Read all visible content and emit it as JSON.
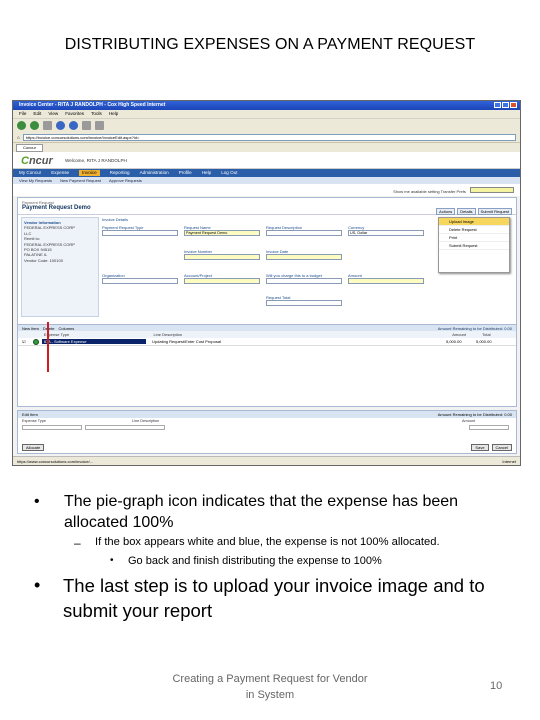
{
  "slide": {
    "title": "DISTRIBUTING EXPENSES ON A PAYMENT REQUEST",
    "bullets": {
      "b1": "The pie-graph icon indicates that the expense has been allocated 100%",
      "b1_sub": "If the box appears white and blue, the expense is not 100% allocated.",
      "b1_subsub": "Go back and finish distributing the expense to 100%",
      "b2": "The last step is to upload your invoice image and to submit your report"
    },
    "footer": "Creating a Payment Request for Vendor in System",
    "page_number": "10"
  },
  "screenshot": {
    "window_title": "Invoice Center - RITA J RANDOLPH - Cox High Speed Internet",
    "menu": [
      "File",
      "Edit",
      "View",
      "Favorites",
      "Tools",
      "Help"
    ],
    "address": "https://invoice.concursolutions.com/invoice/InvoiceEdit.aspx?id=",
    "welcome": "Welcome, RITA J RANDOLPH",
    "nav": [
      "My Concur",
      "Expense",
      "Invoice",
      "Reporting",
      "Administration",
      "Profile",
      "Help",
      "Log Out"
    ],
    "nav_active": "Invoice",
    "subnav": [
      "View My Requests",
      "New Payment Request",
      "Approve Requests"
    ],
    "prefs_label": "Show me available setting Transfer Prefs",
    "request_id": "Payment Request",
    "request_name": "Payment Request Demo",
    "head_actions": [
      "Actions",
      "Details",
      "Submit Request"
    ],
    "vendor_label": "Vendor Information",
    "vendor_lines": [
      "FEDERAL EXPRESS CORP",
      "LLC",
      "",
      "Remit to:",
      "FEDERAL EXPRESS CORP",
      "PO BOX 94515",
      "PALATINE IL",
      "",
      "Vendor Code: 100100"
    ],
    "invoice_details_label": "Invoice Details",
    "fields": {
      "req_type": "Payment Request Type",
      "req_name": "Request Name",
      "req_desc": "Request Description",
      "req_name_val": "Payment Request Demo",
      "invoice_number": "Invoice Number",
      "invoice_date": "Invoice Date",
      "currency": "Currency",
      "currency_val": "US, Dollar",
      "organization": "Organization",
      "account_project": "Account/Project",
      "ship_charges": "Will you charge this to a budget",
      "amount": "Amount",
      "total": "Request Total"
    },
    "side_menu": [
      "Upload Image",
      "Delete Request",
      "Print",
      "Submit Request"
    ],
    "expense_tools": [
      "New Item",
      "Delete",
      "Columns"
    ],
    "amount_remaining": "Amount Remaining to be Distributed: 0.00",
    "expense_cols": [
      "",
      "Expense Type",
      "Line Description",
      "Amount",
      "Total"
    ],
    "expense_row": {
      "type": "IDA - Software Expense",
      "desc": "Updating Request/Enter Cost Proposal",
      "amount": "5,000.00",
      "total": "5,000.00"
    },
    "edit_label": "Edit Item",
    "edit_remaining": "Amount Remaining to be Distributed: 0.00",
    "edit_cols": [
      "Expense Type",
      "Line Description",
      "Amount"
    ],
    "edit_buttons": [
      "Allocate",
      "Save",
      "Cancel"
    ],
    "status_left": "https://www.concursolutions.com/invoice/...",
    "status_zone": "Internet"
  },
  "colors": {
    "concur_green": "#5aa02c",
    "nav_blue": "#2a5ea8",
    "pie_green": "#2e9d3b",
    "arrow_red": "#d21b1b"
  }
}
